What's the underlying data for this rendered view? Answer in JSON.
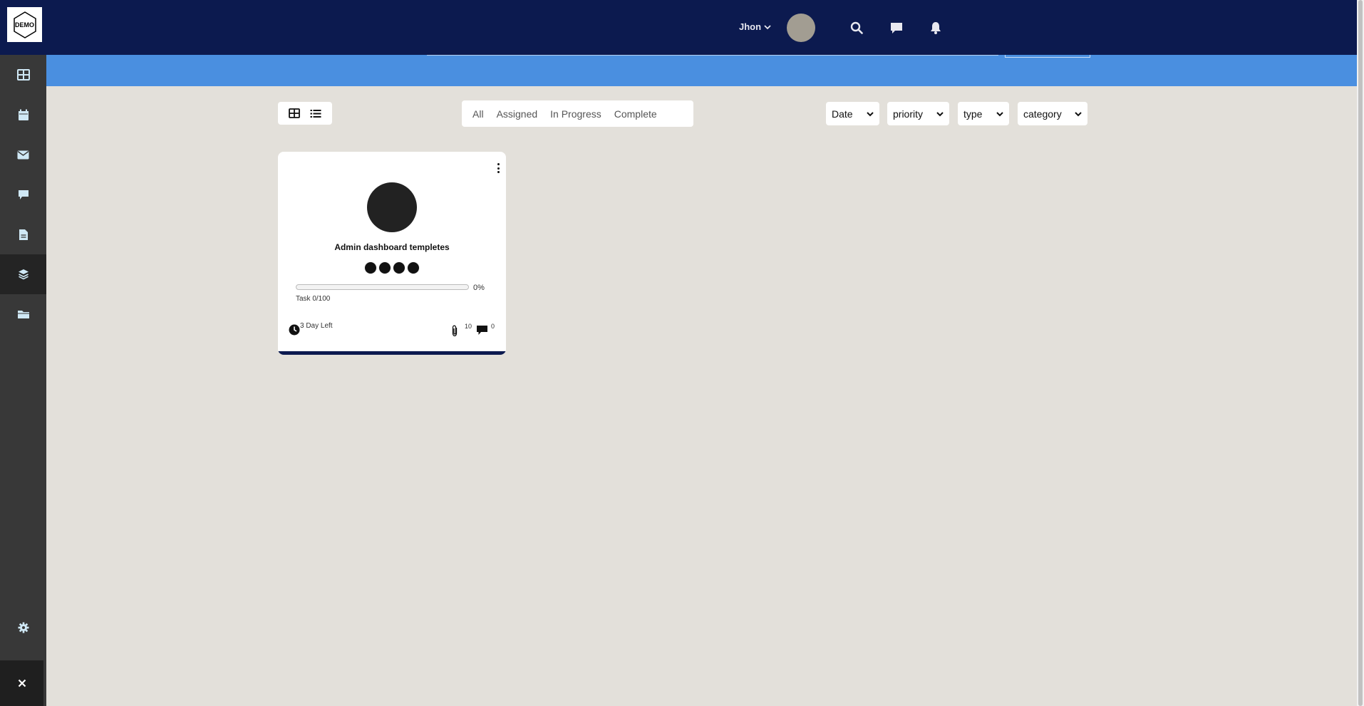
{
  "app": {
    "logo_text": "DEMO"
  },
  "header": {
    "user_name": "Jhon",
    "icons": [
      "search-icon",
      "chat-icon",
      "bell-icon"
    ]
  },
  "sidebar": {
    "items": [
      {
        "icon": "dashboard-icon"
      },
      {
        "icon": "calendar-icon"
      },
      {
        "icon": "mail-icon"
      },
      {
        "icon": "chat-icon"
      },
      {
        "icon": "document-icon"
      },
      {
        "icon": "layers-icon",
        "active": true
      },
      {
        "icon": "folder-icon"
      }
    ],
    "settings_icon": "gear-icon",
    "close_icon": "close-icon"
  },
  "toolbar": {
    "tabs": [
      "All",
      "Assigned",
      "In Progress",
      "Complete"
    ],
    "filters": [
      "Date",
      "priority",
      "type",
      "category"
    ]
  },
  "card": {
    "title": "Admin dashboard templetes",
    "progress_percent": 0,
    "progress_label": "0%",
    "task_label": "Task 0/100",
    "time_left": "3 Day Left",
    "attachments": "10",
    "comments": "0",
    "member_count": 4
  },
  "colors": {
    "header": "#0c1a4f",
    "sidebar": "#383838",
    "banner": "#4a8fe0",
    "background": "#e3e0da"
  }
}
